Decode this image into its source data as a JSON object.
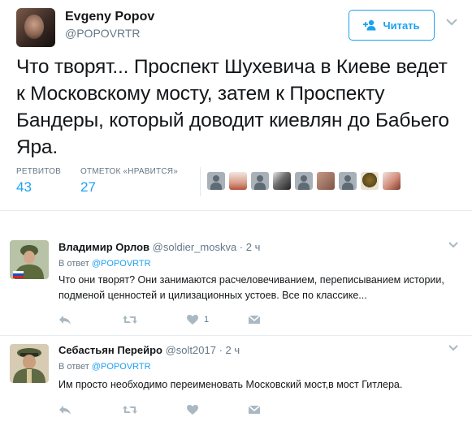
{
  "tweet": {
    "author_name": "Evgeny Popov",
    "author_handle": "@POPOVRTR",
    "follow_label": "Читать",
    "text": "Что творят... Проспект Шухевича в Киеве ведет к Московскому мосту, затем к Проспекту Бандеры, который доводит киевлян до Бабьего Яра.",
    "retweets_label": "РЕТВИТОВ",
    "retweets": "43",
    "likes_label": "ОТМЕТОК «НРАВИТСЯ»",
    "likes": "27"
  },
  "replies": [
    {
      "name": "Владимир Орлов",
      "handle": "@soldier_moskva",
      "time": "2 ч",
      "in_reply_prefix": "В ответ",
      "in_reply_to": "@POPOVRTR",
      "text": "Что они творят? Они занимаются расчеловечиванием, переписыванием истории, подменой ценностей и цилизационных устоев. Все по классике...",
      "like_count": "1"
    },
    {
      "name": "Себастьян Перейро",
      "handle": "@solt2017",
      "time": "2 ч",
      "in_reply_prefix": "В ответ",
      "in_reply_to": "@POPOVRTR",
      "text": "Им просто необходимо переименовать Московский мост,в мост Гитлера.",
      "like_count": ""
    }
  ],
  "colors": {
    "accent": "#1da1f2",
    "secondary_text": "#657786",
    "icon_gray": "#aab8c2"
  }
}
